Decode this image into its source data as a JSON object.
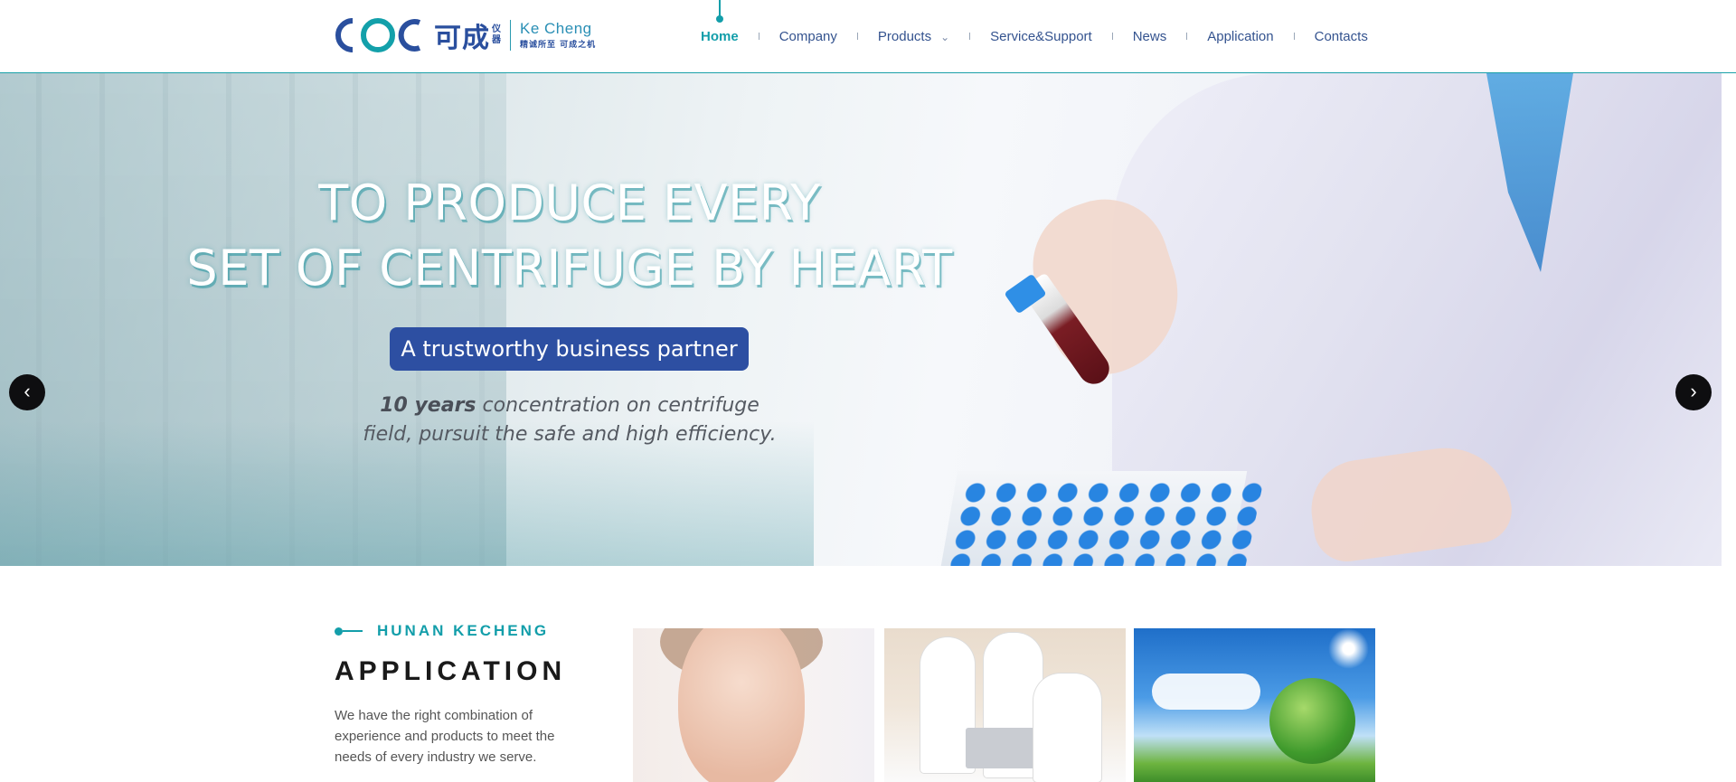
{
  "brand": {
    "cn_name": "可成",
    "cn_small": [
      "仪",
      "器"
    ],
    "en_name": "Ke Cheng",
    "cn_slogan": "精诚所至  可成之机"
  },
  "nav": {
    "items": [
      {
        "label": "Home",
        "active": true
      },
      {
        "label": "Company"
      },
      {
        "label": "Products",
        "has_dropdown": true
      },
      {
        "label": "Service&Support"
      },
      {
        "label": "News"
      },
      {
        "label": "Application"
      },
      {
        "label": "Contacts"
      }
    ]
  },
  "hero": {
    "title_line1": "TO PRODUCE EVERY",
    "title_line2": "SET OF CENTRIFUGE BY HEART",
    "badge": "A trustworthy business partner",
    "desc_bold": "10 years",
    "desc_rest": " concentration on centrifuge field, pursuit the safe and high efficiency.",
    "prev_icon": "chevron-left-icon",
    "next_icon": "chevron-right-icon",
    "slides_total": 3,
    "active_slide": 1
  },
  "application": {
    "kicker": "HUNAN KECHENG",
    "title": "APPLICATION",
    "description": "We have the right combination of experience and products to meet the needs of every industry we serve."
  },
  "colors": {
    "accent": "#139eaa",
    "brand_blue": "#2d4fa2",
    "nav_text": "#34538f"
  }
}
